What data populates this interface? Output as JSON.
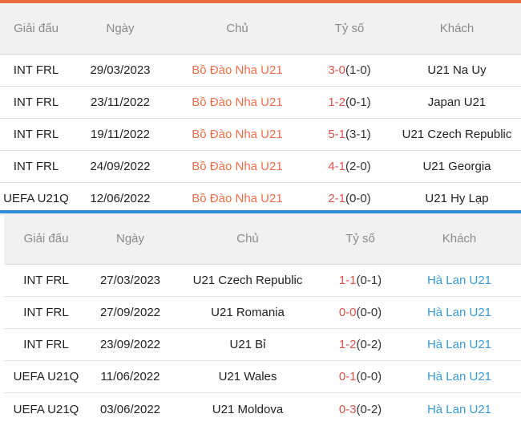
{
  "colors": {
    "accent_orange": "#e87040",
    "accent_blue": "#2a8fd6",
    "home_text": "#e8704a",
    "away_text": "#3a9ad9",
    "score_red": "#d9534f"
  },
  "table_a": {
    "headers": [
      "Giải đấu",
      "Ngày",
      "Chủ",
      "Tỷ số",
      "Khách"
    ],
    "rows": [
      {
        "league": "INT FRL",
        "date": "29/03/2023",
        "home": "Bồ Đào Nha U21",
        "score_ft": "3-0",
        "score_ht": "(1-0)",
        "away": "U21 Na Uy"
      },
      {
        "league": "INT FRL",
        "date": "23/11/2022",
        "home": "Bồ Đào Nha U21",
        "score_ft": "1-2",
        "score_ht": "(0-1)",
        "away": "Japan U21"
      },
      {
        "league": "INT FRL",
        "date": "19/11/2022",
        "home": "Bồ Đào Nha U21",
        "score_ft": "5-1",
        "score_ht": "(3-1)",
        "away": "U21 Czech Republic"
      },
      {
        "league": "INT FRL",
        "date": "24/09/2022",
        "home": "Bồ Đào Nha U21",
        "score_ft": "4-1",
        "score_ht": "(2-0)",
        "away": "U21 Georgia"
      },
      {
        "league": "UEFA U21Q",
        "date": "12/06/2022",
        "home": "Bồ Đào Nha U21",
        "score_ft": "2-1",
        "score_ht": "(0-0)",
        "away": "U21 Hy Lạp"
      }
    ]
  },
  "table_b": {
    "headers": [
      "Giải đấu",
      "Ngày",
      "Chủ",
      "Tỷ số",
      "Khách"
    ],
    "rows": [
      {
        "league": "INT FRL",
        "date": "27/03/2023",
        "home": "U21 Czech Republic",
        "score_ft": "1-1",
        "score_ht": "(0-1)",
        "away": "Hà Lan U21"
      },
      {
        "league": "INT FRL",
        "date": "27/09/2022",
        "home": "U21 Romania",
        "score_ft": "0-0",
        "score_ht": "(0-0)",
        "away": "Hà Lan U21"
      },
      {
        "league": "INT FRL",
        "date": "23/09/2022",
        "home": "U21 Bỉ",
        "score_ft": "1-2",
        "score_ht": "(0-2)",
        "away": "Hà Lan U21"
      },
      {
        "league": "UEFA U21Q",
        "date": "11/06/2022",
        "home": "U21 Wales",
        "score_ft": "0-1",
        "score_ht": "(0-0)",
        "away": "Hà Lan U21"
      },
      {
        "league": "UEFA U21Q",
        "date": "03/06/2022",
        "home": "U21 Moldova",
        "score_ft": "0-3",
        "score_ht": "(0-2)",
        "away": "Hà Lan U21"
      }
    ]
  }
}
